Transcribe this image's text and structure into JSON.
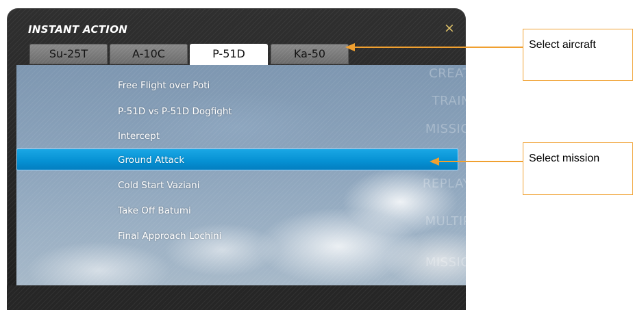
{
  "window": {
    "title": "INSTANT ACTION",
    "close_glyph": "×"
  },
  "tabs": [
    {
      "label": "Su-25T",
      "active": false
    },
    {
      "label": "A-10C",
      "active": false
    },
    {
      "label": "P-51D",
      "active": true
    },
    {
      "label": "Ka-50",
      "active": false
    }
  ],
  "missions": [
    {
      "label": "Free Flight over Poti",
      "selected": false
    },
    {
      "label": "P-51D vs P-51D Dogfight",
      "selected": false
    },
    {
      "label": "Intercept",
      "selected": false
    },
    {
      "label": "Ground Attack",
      "selected": true
    },
    {
      "label": "Cold Start Vaziani",
      "selected": false
    },
    {
      "label": "Take Off Batumi",
      "selected": false
    },
    {
      "label": "Final Approach Lochini",
      "selected": false
    }
  ],
  "background_menu": [
    "CREAT",
    "TRAIN",
    "MISSIO",
    "REPLAY",
    "MULTIP",
    "MISSIO"
  ],
  "callouts": {
    "aircraft": "Select aircraft",
    "mission": "Select mission"
  },
  "colors": {
    "highlight": "#0590d3",
    "callout_border": "#f0a030",
    "close_icon": "#e2c46a"
  }
}
